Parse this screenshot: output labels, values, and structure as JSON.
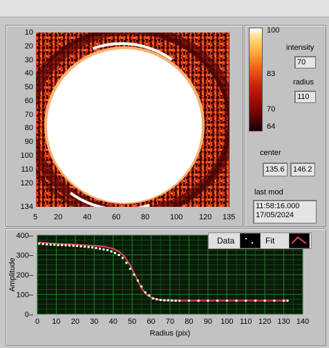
{
  "window": {
    "topbar": ""
  },
  "image": {
    "y_ticks": [
      "10",
      "20",
      "30",
      "40",
      "50",
      "60",
      "70",
      "80",
      "90",
      "100",
      "110",
      "120",
      "134"
    ],
    "x_ticks": [
      "5",
      "20",
      "40",
      "60",
      "80",
      "100",
      "120",
      "135"
    ]
  },
  "colorbar": {
    "ticks": [
      "100",
      "83",
      "70",
      "64"
    ]
  },
  "controls": {
    "intensity_label": "intensity",
    "intensity_value": "70",
    "radius_label": "radius",
    "radius_value": "110",
    "center_label": "center",
    "center_x": "135.6",
    "center_y": "146.2",
    "lastmod_label": "last mod",
    "lastmod_time": "11:58:16.000",
    "lastmod_date": "17/05/2024"
  },
  "legend": {
    "data_label": "Data",
    "fit_label": "Fit"
  },
  "colors": {
    "fit": "#e04a4a",
    "data": "#ffffff",
    "plot_bg": "#0a1a0a",
    "grid": "#1f7f1f"
  },
  "chart_data": {
    "type": "scatter",
    "xlabel": "Radius (pix)",
    "ylabel": "Amplitude",
    "xlim": [
      0,
      140
    ],
    "ylim": [
      0,
      400
    ],
    "x_ticks": [
      "0",
      "10",
      "20",
      "30",
      "40",
      "50",
      "60",
      "70",
      "80",
      "90",
      "100",
      "110",
      "120",
      "130",
      "140"
    ],
    "y_ticks": [
      "400",
      "300",
      "200",
      "100",
      "0"
    ],
    "grid": true,
    "legend_position": "top-right",
    "series": [
      {
        "name": "Data",
        "x": [
          1,
          3,
          5,
          7,
          9,
          11,
          13,
          15,
          17,
          19,
          21,
          23,
          25,
          27,
          29,
          31,
          33,
          35,
          37,
          39,
          41,
          43,
          45,
          47,
          49,
          51,
          53,
          55,
          57,
          59,
          61,
          63,
          65,
          67,
          69,
          71,
          73,
          75,
          80,
          85,
          90,
          95,
          100,
          105,
          110,
          115,
          120,
          125,
          130,
          132
        ],
        "y": [
          358,
          356,
          354,
          352,
          352,
          350,
          350,
          349,
          348,
          347,
          346,
          344,
          342,
          340,
          338,
          335,
          332,
          328,
          325,
          318,
          310,
          300,
          285,
          260,
          230,
          200,
          170,
          140,
          110,
          95,
          80,
          75,
          72,
          70,
          70,
          69,
          68,
          68,
          68,
          68,
          68,
          68,
          68,
          68,
          68,
          68,
          68,
          68,
          68,
          68
        ]
      },
      {
        "name": "Fit",
        "x": [
          1,
          5,
          10,
          15,
          20,
          25,
          30,
          35,
          40,
          43,
          46,
          49,
          52,
          55,
          58,
          61,
          64,
          67,
          70,
          75,
          80,
          90,
          100,
          110,
          120,
          132
        ],
        "y": [
          364,
          360,
          357,
          355,
          353,
          350,
          347,
          343,
          332,
          318,
          292,
          248,
          190,
          130,
          95,
          80,
          73,
          70,
          68,
          68,
          68,
          68,
          68,
          68,
          68,
          68
        ]
      }
    ]
  }
}
